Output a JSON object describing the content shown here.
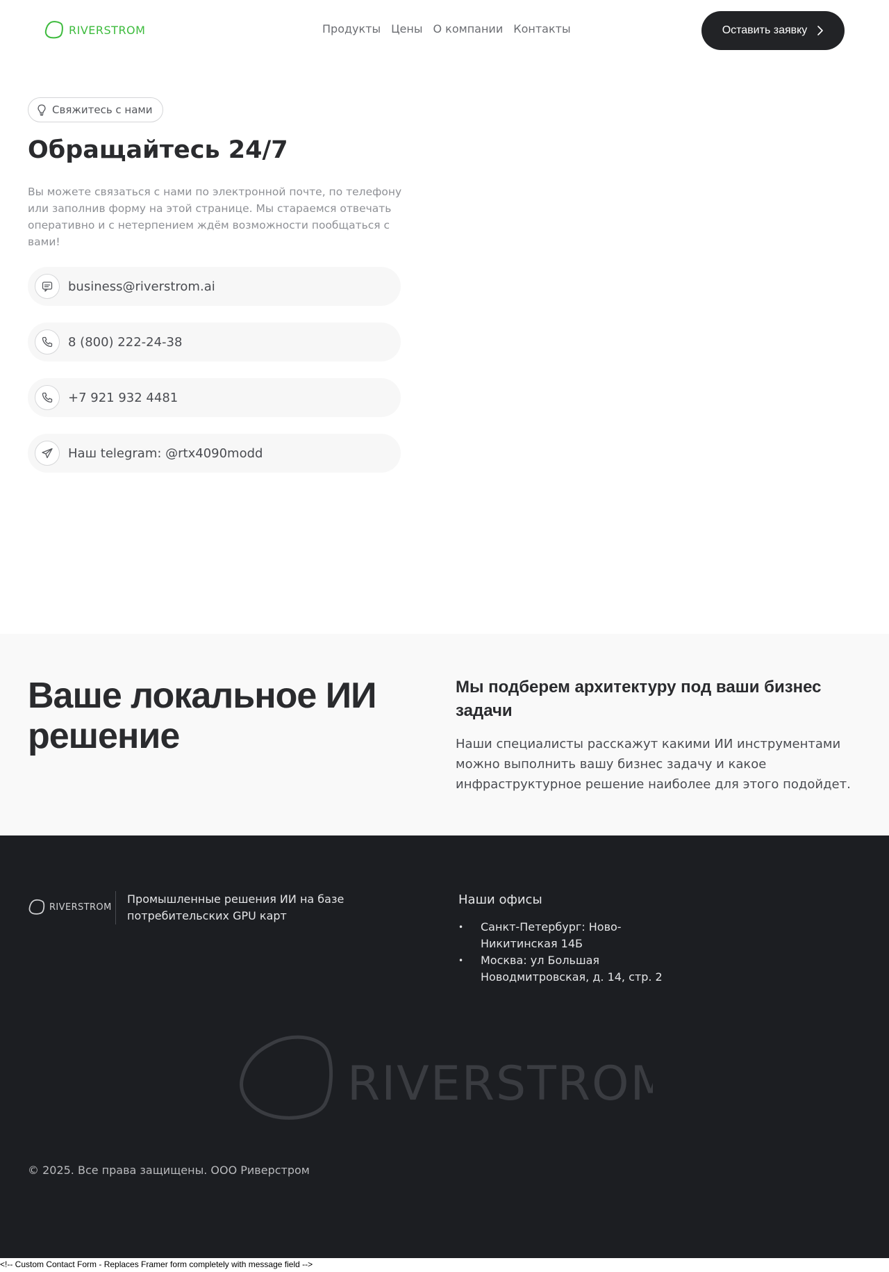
{
  "brand": {
    "name": "RIVERSTROM",
    "accent": "#3dbb3d",
    "dark": "#1c1e22"
  },
  "header": {
    "nav": [
      "Продукты",
      "Цены",
      "О компании",
      "Контакты"
    ],
    "cta_label": "Оставить заявку",
    "cta_icon": "chevron-right-icon"
  },
  "contact": {
    "pill_label": "Свяжитесь с нами",
    "pill_icon": "lightbulb-icon",
    "title": "Обращайтесь 24/7",
    "lead": "Вы можете связаться с нами по электронной почте, по телефону или заполнив форму на этой странице. Мы стараемся отвечать оперативно и с нетерпением ждём возможности пообщаться с вами!",
    "items": [
      {
        "icon": "message-icon",
        "text": "business@riverstrom.ai"
      },
      {
        "icon": "phone-icon",
        "text": "8 (800) 222-24-38"
      },
      {
        "icon": "phone-icon",
        "text": "+7 921 932 4481"
      },
      {
        "icon": "telegram-icon",
        "text": "Наш telegram: @rtx4090modd"
      }
    ]
  },
  "promo": {
    "title": "Ваше локальное ИИ решение",
    "subtitle": "Мы подберем архитектуру под ваши бизнес задачи",
    "text": "Наши специалисты расскажут какими ИИ инструментами можно выполнить вашу бизнес задачу и какое инфраструктурное решение наиболее для этого подойдет."
  },
  "footer": {
    "tagline": "Промышленные решения ИИ на базе потребительских GPU карт",
    "offices_title": "Наши офисы",
    "offices": [
      "Санкт-Петербург: Ново-Никитинская 14Б",
      "Москва: ул Большая Новодмитровская, д. 14, стр. 2"
    ],
    "copyright": "© 2025. Все права защищены. ООО Риверстром"
  },
  "raw_comment": "<!-- Custom Contact Form - Replaces Framer form completely with message field -->"
}
